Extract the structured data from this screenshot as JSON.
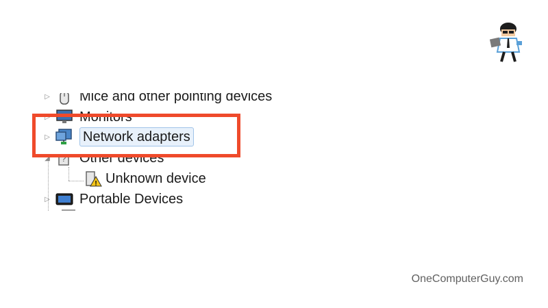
{
  "tree": {
    "items": [
      {
        "label": "Mice and other pointing devices"
      },
      {
        "label": "Monitors"
      },
      {
        "label": "Network adapters"
      },
      {
        "label": "Other devices"
      },
      {
        "label": "Unknown device"
      },
      {
        "label": "Portable Devices"
      }
    ]
  },
  "branding": {
    "watermark": "OneComputerGuy.com",
    "logo_icon": "computer-guy-logo"
  },
  "colors": {
    "highlight": "#ef4a2b",
    "selection_bg": "#e8f1fb"
  }
}
